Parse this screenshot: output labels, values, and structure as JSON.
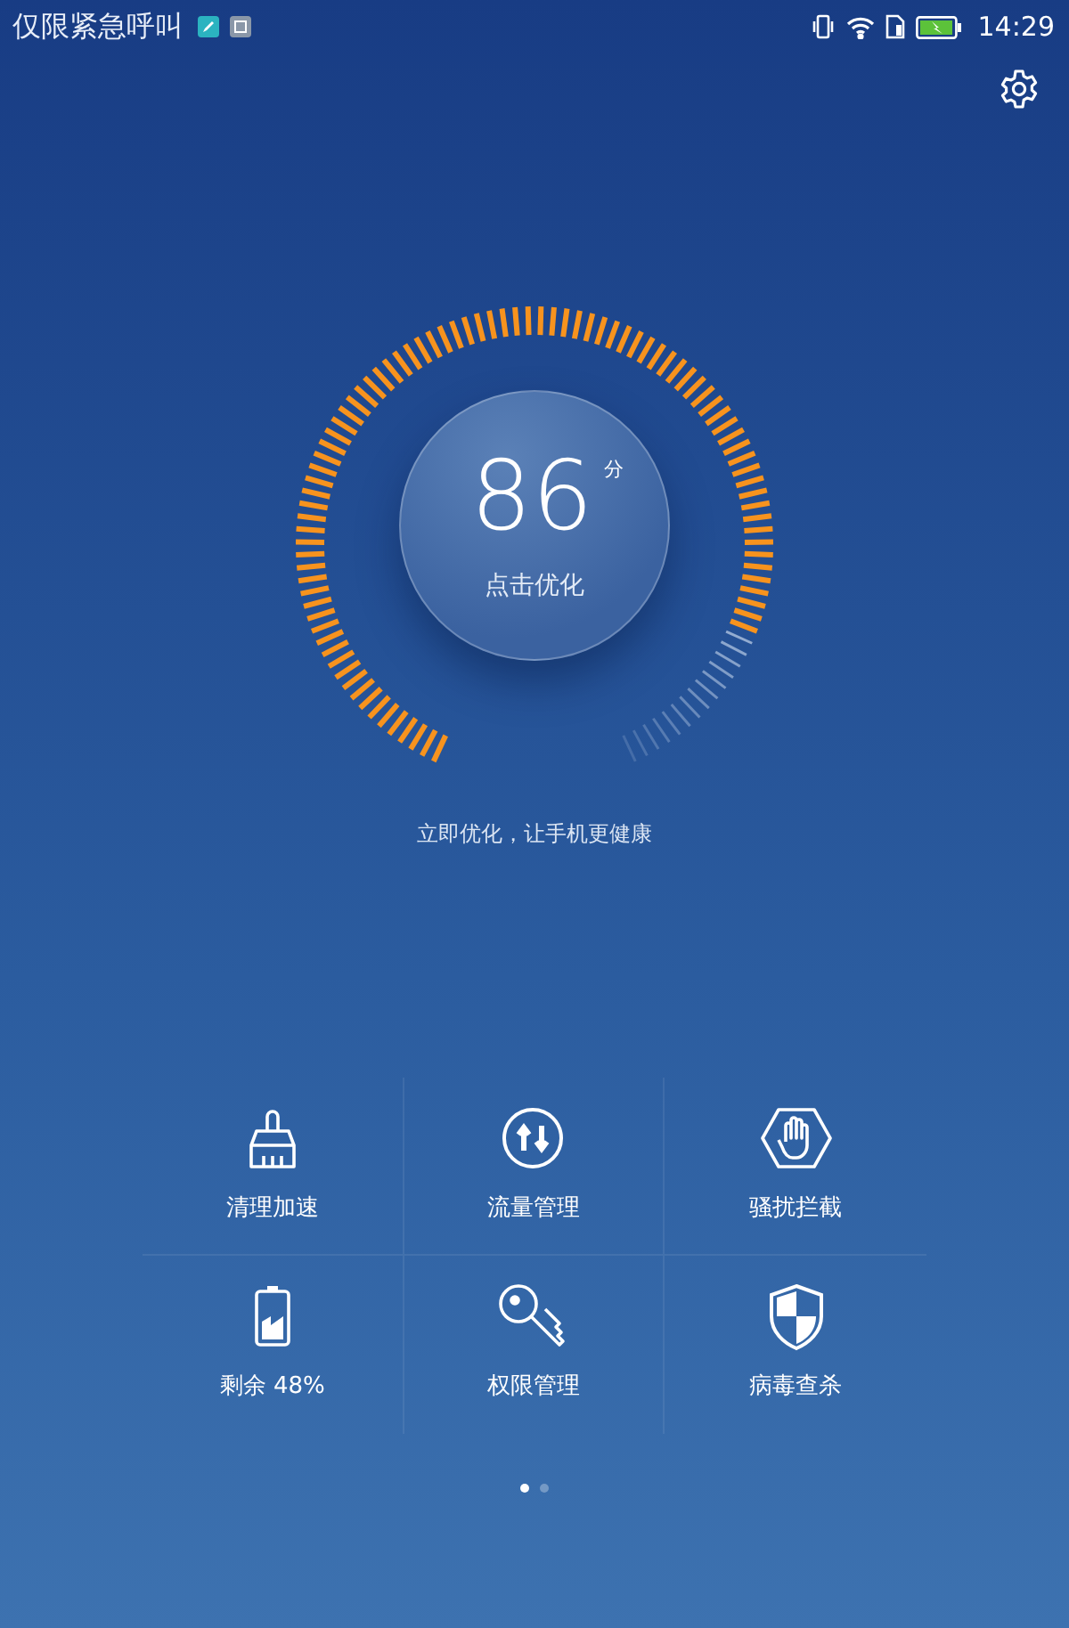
{
  "status_bar": {
    "carrier": "仅限紧急呼叫",
    "time": "14:29"
  },
  "gauge": {
    "score": "86",
    "unit": "分",
    "action": "点击优化"
  },
  "tagline": "立即优化，让手机更健康",
  "tiles": [
    {
      "kind": "clean",
      "label": "清理加速"
    },
    {
      "kind": "traffic",
      "label": "流量管理"
    },
    {
      "kind": "block",
      "label": "骚扰拦截"
    },
    {
      "kind": "battery",
      "label": "剩余 48%"
    },
    {
      "kind": "permission",
      "label": "权限管理"
    },
    {
      "kind": "virus",
      "label": "病毒查杀"
    }
  ],
  "pages": [
    {
      "selected": true
    },
    {
      "selected": false
    }
  ]
}
